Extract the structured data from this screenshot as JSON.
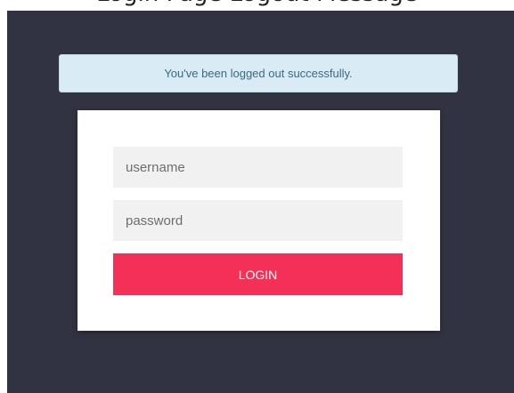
{
  "page": {
    "top_heading": "Login Page Logout Message"
  },
  "alert": {
    "message": "You've been logged out successfully."
  },
  "login_form": {
    "username_placeholder": "username",
    "username_value": "",
    "password_placeholder": "password",
    "password_value": "",
    "submit_label": "LOGIN"
  },
  "colors": {
    "background": "#323342",
    "alert_bg": "#d9ebf4",
    "alert_text": "#3b6a86",
    "card_bg": "#ffffff",
    "input_bg": "#f1f1f1",
    "button_bg": "#f43056",
    "button_text": "#ffffff"
  }
}
